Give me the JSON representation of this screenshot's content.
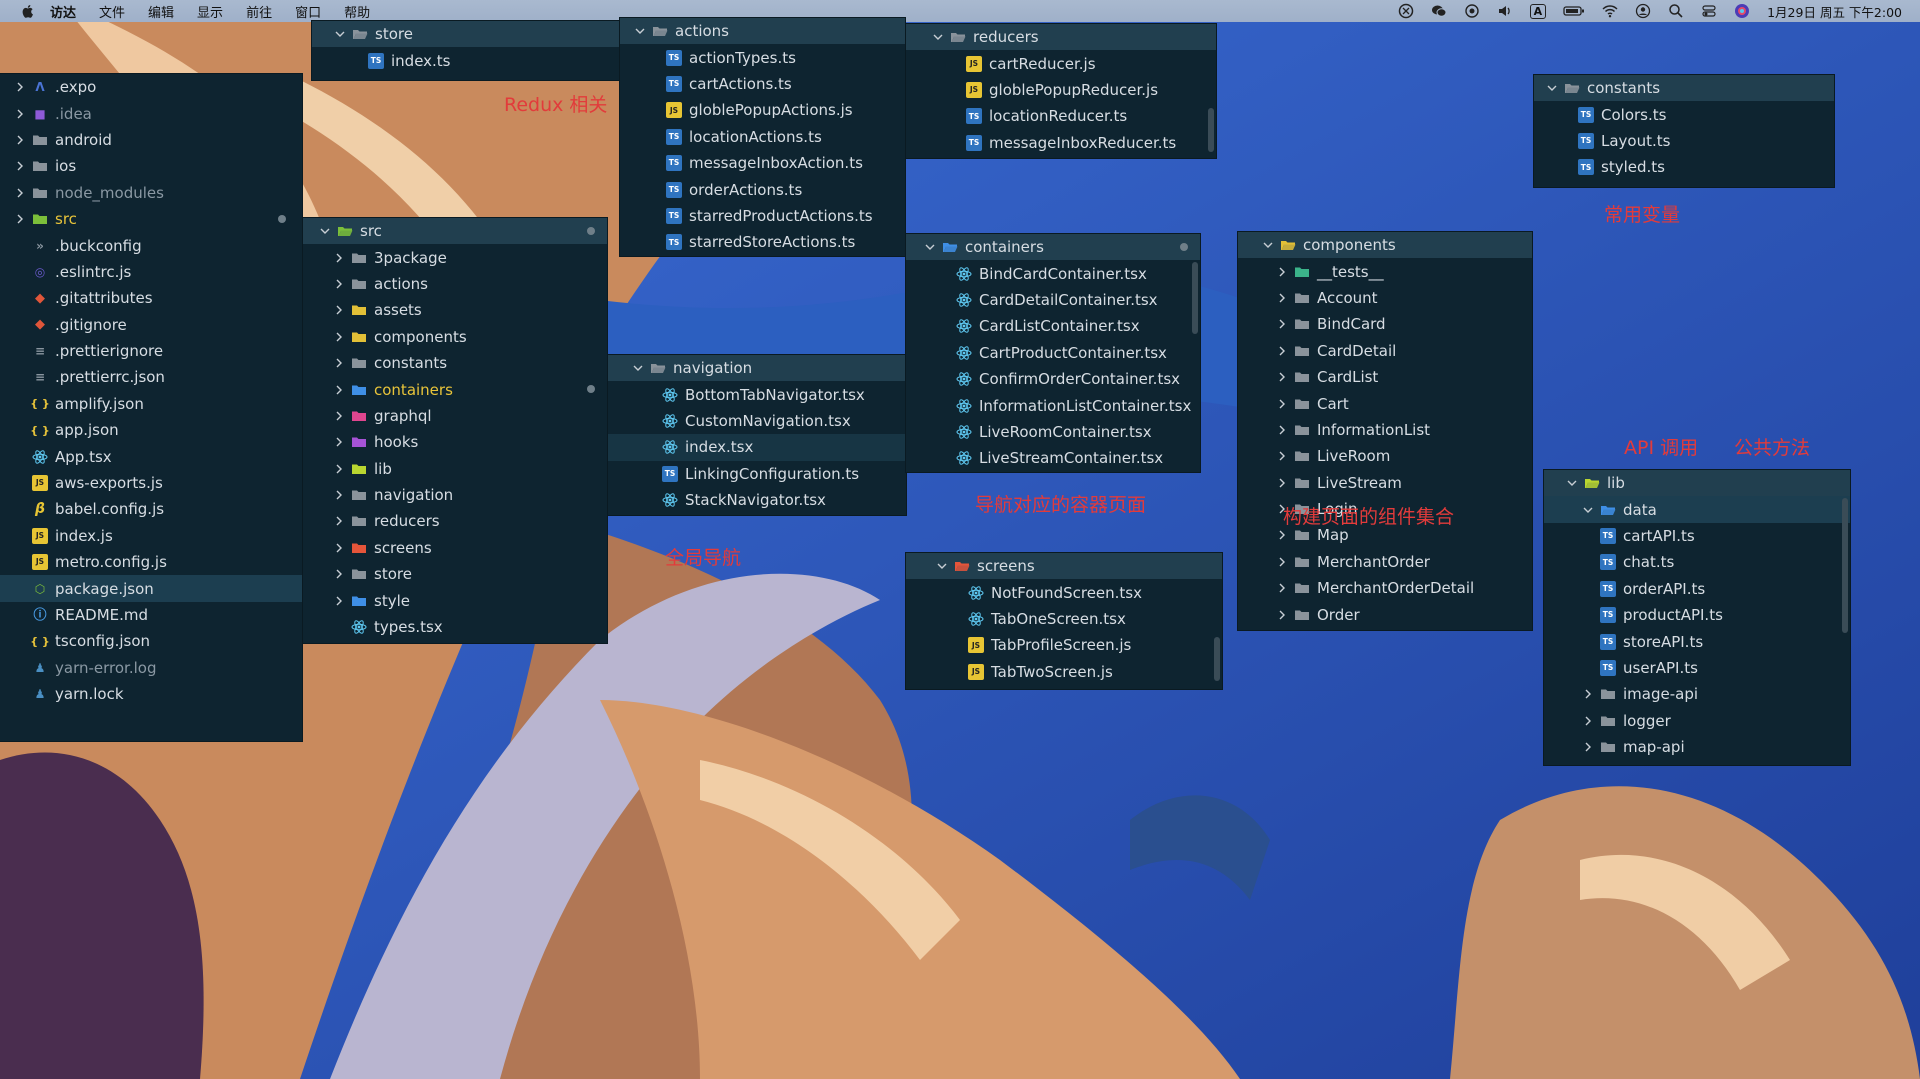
{
  "menubar": {
    "items": [
      "访达",
      "文件",
      "编辑",
      "显示",
      "前往",
      "窗口",
      "帮助"
    ],
    "clock": "1月29日 周五 下午2:00",
    "input_indicator": "A"
  },
  "annotations": {
    "redux": "Redux 相关",
    "navigation": "全局导航",
    "containers": "导航对应的容器页面",
    "components": "构建页面的组件集合",
    "constants": "常用变量",
    "api": "API 调用",
    "helpers": "公共方法"
  },
  "panels": {
    "root": {
      "rows": [
        {
          "label": ".expo",
          "icon": "expo",
          "chev": "right"
        },
        {
          "label": ".idea",
          "icon": "idea",
          "chev": "right",
          "dim": true
        },
        {
          "label": "android",
          "icon": "folder-android",
          "chev": "right"
        },
        {
          "label": "ios",
          "icon": "folder-ios",
          "chev": "right"
        },
        {
          "label": "node_modules",
          "icon": "folder-node",
          "chev": "right",
          "dim": true
        },
        {
          "label": "src",
          "icon": "folder-src",
          "chev": "right",
          "mod": true,
          "dot": true
        },
        {
          "label": ".buckconfig",
          "icon": "buck"
        },
        {
          "label": ".eslintrc.js",
          "icon": "eslint"
        },
        {
          "label": ".gitattributes",
          "icon": "git"
        },
        {
          "label": ".gitignore",
          "icon": "git"
        },
        {
          "label": ".prettierignore",
          "icon": "prettier"
        },
        {
          "label": ".prettierrc.json",
          "icon": "prettier"
        },
        {
          "label": "amplify.json",
          "icon": "json"
        },
        {
          "label": "app.json",
          "icon": "json"
        },
        {
          "label": "App.tsx",
          "icon": "react"
        },
        {
          "label": "aws-exports.js",
          "icon": "js"
        },
        {
          "label": "babel.config.js",
          "icon": "babel"
        },
        {
          "label": "index.js",
          "icon": "js"
        },
        {
          "label": "metro.config.js",
          "icon": "js"
        },
        {
          "label": "package.json",
          "icon": "node",
          "selected": true
        },
        {
          "label": "README.md",
          "icon": "md"
        },
        {
          "label": "tsconfig.json",
          "icon": "json"
        },
        {
          "label": "yarn-error.log",
          "icon": "yarn",
          "dim": true
        },
        {
          "label": "yarn.lock",
          "icon": "yarn"
        }
      ]
    },
    "store": {
      "rows": [
        {
          "label": "store",
          "icon": "folder-open",
          "chev": "down",
          "header": true
        },
        {
          "label": "index.ts",
          "icon": "ts"
        }
      ]
    },
    "actions": {
      "rows": [
        {
          "label": "actions",
          "icon": "folder-open",
          "chev": "down",
          "header": true
        },
        {
          "label": "actionTypes.ts",
          "icon": "ts"
        },
        {
          "label": "cartActions.ts",
          "icon": "ts"
        },
        {
          "label": "globlePopupActions.js",
          "icon": "js"
        },
        {
          "label": "locationActions.ts",
          "icon": "ts"
        },
        {
          "label": "messageInboxAction.ts",
          "icon": "ts"
        },
        {
          "label": "orderActions.ts",
          "icon": "ts"
        },
        {
          "label": "starredProductActions.ts",
          "icon": "ts"
        },
        {
          "label": "starredStoreActions.ts",
          "icon": "ts"
        }
      ]
    },
    "reducers": {
      "rows": [
        {
          "label": "reducers",
          "icon": "folder-open",
          "chev": "down",
          "header": true
        },
        {
          "label": "cartReducer.js",
          "icon": "js"
        },
        {
          "label": "globlePopupReducer.js",
          "icon": "js"
        },
        {
          "label": "locationReducer.ts",
          "icon": "ts"
        },
        {
          "label": "messageInboxReducer.ts",
          "icon": "ts"
        }
      ]
    },
    "constants": {
      "rows": [
        {
          "label": "constants",
          "icon": "folder-open",
          "chev": "down",
          "header": true
        },
        {
          "label": "Colors.ts",
          "icon": "ts"
        },
        {
          "label": "Layout.ts",
          "icon": "ts"
        },
        {
          "label": "styled.ts",
          "icon": "ts"
        }
      ]
    },
    "src": {
      "rows": [
        {
          "label": "src",
          "icon": "folder-src-open",
          "chev": "down",
          "header": true,
          "dot": true
        },
        {
          "label": "3package",
          "icon": "folder",
          "chev": "right"
        },
        {
          "label": "actions",
          "icon": "folder",
          "chev": "right"
        },
        {
          "label": "assets",
          "icon": "folder-yellow",
          "chev": "right"
        },
        {
          "label": "components",
          "icon": "folder-yellow",
          "chev": "right"
        },
        {
          "label": "constants",
          "icon": "folder-gray",
          "chev": "right"
        },
        {
          "label": "containers",
          "icon": "folder-blue",
          "chev": "right",
          "mod": true,
          "dot": true
        },
        {
          "label": "graphql",
          "icon": "folder-pink",
          "chev": "right"
        },
        {
          "label": "hooks",
          "icon": "folder-purple",
          "chev": "right"
        },
        {
          "label": "lib",
          "icon": "folder-lime",
          "chev": "right"
        },
        {
          "label": "navigation",
          "icon": "folder",
          "chev": "right"
        },
        {
          "label": "reducers",
          "icon": "folder",
          "chev": "right"
        },
        {
          "label": "screens",
          "icon": "folder-red",
          "chev": "right"
        },
        {
          "label": "store",
          "icon": "folder",
          "chev": "right"
        },
        {
          "label": "style",
          "icon": "folder-blue",
          "chev": "right"
        },
        {
          "label": "types.tsx",
          "icon": "react"
        }
      ]
    },
    "navigation": {
      "rows": [
        {
          "label": "navigation",
          "icon": "folder-open",
          "chev": "down",
          "header": true
        },
        {
          "label": "BottomTabNavigator.tsx",
          "icon": "react"
        },
        {
          "label": "CustomNavigation.tsx",
          "icon": "react"
        },
        {
          "label": "index.tsx",
          "icon": "react",
          "hover": true
        },
        {
          "label": "LinkingConfiguration.ts",
          "icon": "ts"
        },
        {
          "label": "StackNavigator.tsx",
          "icon": "react"
        }
      ]
    },
    "containers": {
      "rows": [
        {
          "label": "containers",
          "icon": "folder-blue-open",
          "chev": "down",
          "header": true,
          "dot": true
        },
        {
          "label": "BindCardContainer.tsx",
          "icon": "react"
        },
        {
          "label": "CardDetailContainer.tsx",
          "icon": "react"
        },
        {
          "label": "CardListContainer.tsx",
          "icon": "react"
        },
        {
          "label": "CartProductContainer.tsx",
          "icon": "react"
        },
        {
          "label": "ConfirmOrderContainer.tsx",
          "icon": "react"
        },
        {
          "label": "InformationListContainer.tsx",
          "icon": "react"
        },
        {
          "label": "LiveRoomContainer.tsx",
          "icon": "react"
        },
        {
          "label": "LiveStreamContainer.tsx",
          "icon": "react"
        }
      ]
    },
    "screens": {
      "rows": [
        {
          "label": "screens",
          "icon": "folder-red-open",
          "chev": "down",
          "header": true
        },
        {
          "label": "NotFoundScreen.tsx",
          "icon": "react"
        },
        {
          "label": "TabOneScreen.tsx",
          "icon": "react"
        },
        {
          "label": "TabProfileScreen.js",
          "icon": "js"
        },
        {
          "label": "TabTwoScreen.js",
          "icon": "js"
        }
      ]
    },
    "components": {
      "rows": [
        {
          "label": "components",
          "icon": "folder-yellow-open",
          "chev": "down",
          "header": true
        },
        {
          "label": "__tests__",
          "icon": "folder-teal",
          "chev": "right"
        },
        {
          "label": "Account",
          "icon": "folder",
          "chev": "right"
        },
        {
          "label": "BindCard",
          "icon": "folder",
          "chev": "right"
        },
        {
          "label": "CardDetail",
          "icon": "folder",
          "chev": "right"
        },
        {
          "label": "CardList",
          "icon": "folder",
          "chev": "right"
        },
        {
          "label": "Cart",
          "icon": "folder",
          "chev": "right"
        },
        {
          "label": "InformationList",
          "icon": "folder",
          "chev": "right"
        },
        {
          "label": "LiveRoom",
          "icon": "folder",
          "chev": "right"
        },
        {
          "label": "LiveStream",
          "icon": "folder",
          "chev": "right"
        },
        {
          "label": "Login",
          "icon": "folder",
          "chev": "right"
        },
        {
          "label": "Map",
          "icon": "folder",
          "chev": "right"
        },
        {
          "label": "MerchantOrder",
          "icon": "folder",
          "chev": "right"
        },
        {
          "label": "MerchantOrderDetail",
          "icon": "folder",
          "chev": "right"
        },
        {
          "label": "Order",
          "icon": "folder",
          "chev": "right"
        }
      ]
    },
    "lib": {
      "rows": [
        {
          "label": "lib",
          "icon": "folder-lime-open",
          "chev": "down",
          "header": true
        },
        {
          "label": "data",
          "icon": "folder-blue-open",
          "chev": "down",
          "selected": true
        },
        {
          "label": "cartAPI.ts",
          "icon": "ts"
        },
        {
          "label": "chat.ts",
          "icon": "ts"
        },
        {
          "label": "orderAPI.ts",
          "icon": "ts"
        },
        {
          "label": "productAPI.ts",
          "icon": "ts"
        },
        {
          "label": "storeAPI.ts",
          "icon": "ts"
        },
        {
          "label": "userAPI.ts",
          "icon": "ts"
        },
        {
          "label": "image-api",
          "icon": "folder",
          "chev": "right"
        },
        {
          "label": "logger",
          "icon": "folder",
          "chev": "right"
        },
        {
          "label": "map-api",
          "icon": "folder",
          "chev": "right"
        }
      ]
    }
  }
}
